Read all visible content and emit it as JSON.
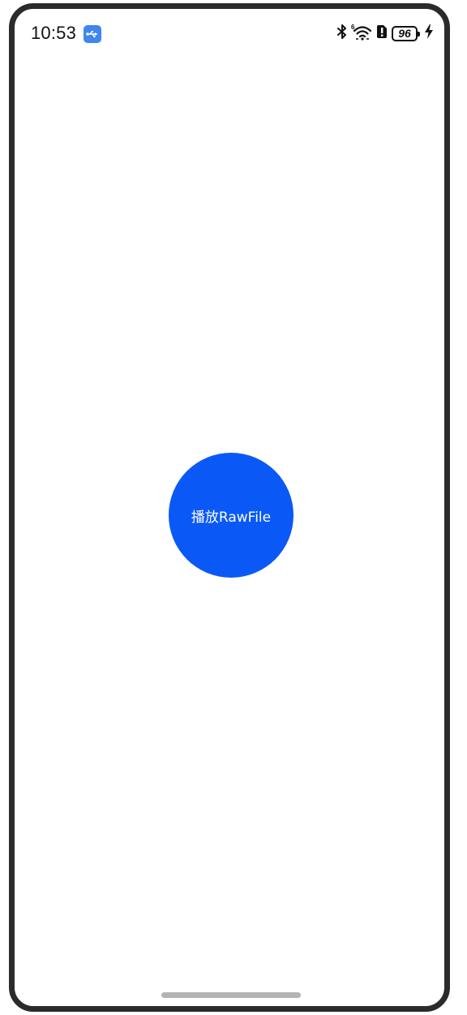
{
  "status_bar": {
    "time": "10:53",
    "battery_level": "96",
    "icons": [
      "usb-debug-icon",
      "bluetooth-icon",
      "wifi-6-icon",
      "sim-alert-icon",
      "battery-icon",
      "charging-bolt-icon"
    ]
  },
  "main": {
    "play_button_label": "播放RawFile"
  },
  "colors": {
    "button_background": "#0a59f7",
    "usb_badge": "#3f86ee",
    "frame_border": "#2b2b2b",
    "home_indicator": "#b3b3b3"
  }
}
